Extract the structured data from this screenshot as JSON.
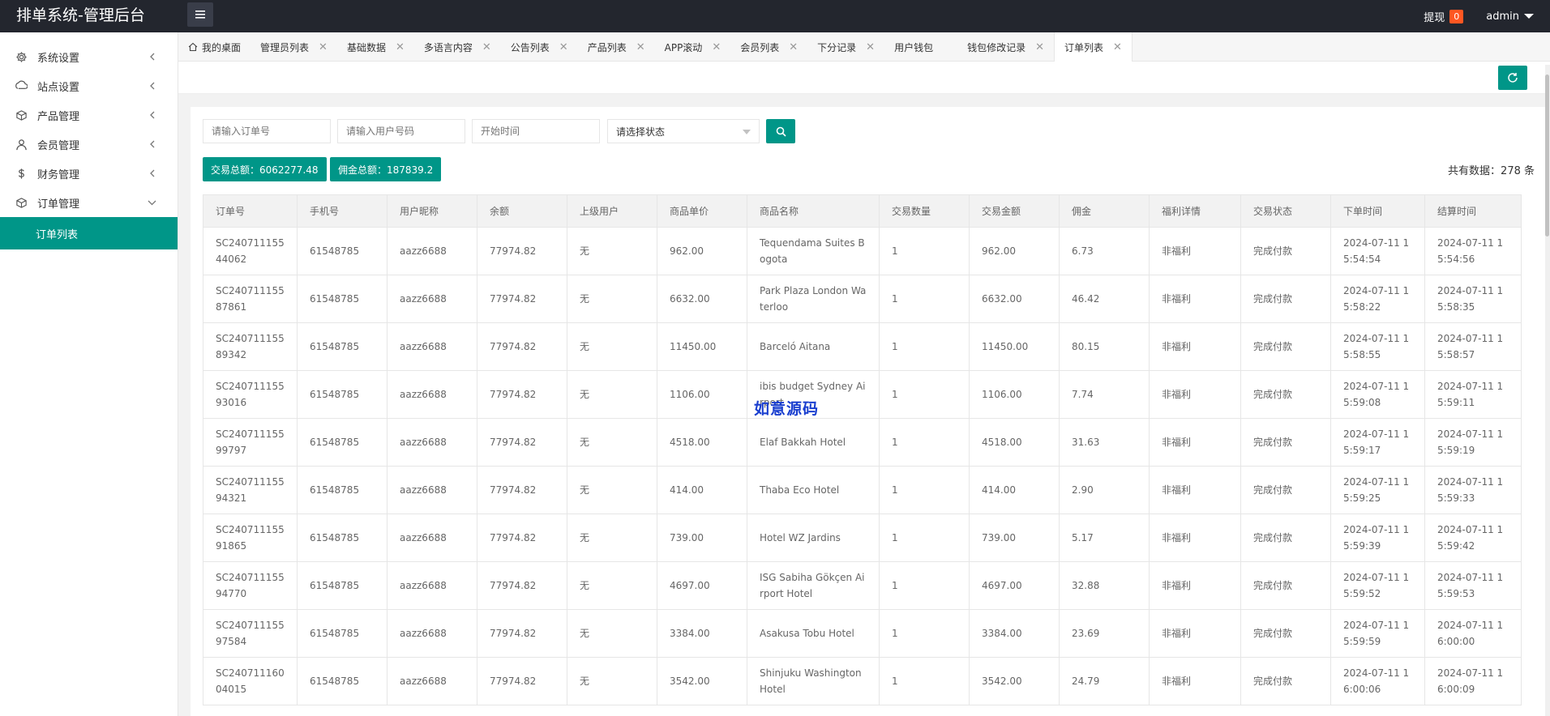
{
  "header": {
    "title": "排单系统-管理后台",
    "withdraw_label": "提现",
    "withdraw_badge": "0",
    "user": "admin"
  },
  "sidebar": {
    "items": [
      {
        "label": "系统设置",
        "icon": "gear-icon"
      },
      {
        "label": "站点设置",
        "icon": "site-icon"
      },
      {
        "label": "产品管理",
        "icon": "box-icon"
      },
      {
        "label": "会员管理",
        "icon": "user-icon"
      },
      {
        "label": "财务管理",
        "icon": "dollar-icon"
      },
      {
        "label": "订单管理",
        "icon": "cube-icon"
      }
    ],
    "sub_active": "订单列表"
  },
  "tabs": [
    {
      "label": "我的桌面",
      "closable": false
    },
    {
      "label": "管理员列表",
      "closable": true
    },
    {
      "label": "基础数据",
      "closable": true
    },
    {
      "label": "多语言内容",
      "closable": true
    },
    {
      "label": "公告列表",
      "closable": true
    },
    {
      "label": "产品列表",
      "closable": true
    },
    {
      "label": "APP滚动",
      "closable": true
    },
    {
      "label": "会员列表",
      "closable": true
    },
    {
      "label": "下分记录",
      "closable": true
    },
    {
      "label": "用户钱包",
      "closable": false
    },
    {
      "label": "钱包修改记录",
      "closable": true
    },
    {
      "label": "订单列表",
      "closable": true,
      "active": true
    }
  ],
  "filters": {
    "order_no_placeholder": "请输入订单号",
    "phone_placeholder": "请输入用户号码",
    "start_time_placeholder": "开始时间",
    "status_select": "请选择状态"
  },
  "summary": {
    "trade_total": "交易总额：6062277.48",
    "commission_total": "佣金总额：187839.2",
    "record_count": "共有数据：278 条"
  },
  "table": {
    "columns": [
      "订单号",
      "手机号",
      "用户昵称",
      "余额",
      "上级用户",
      "商品单价",
      "商品名称",
      "交易数量",
      "交易金额",
      "佣金",
      "福利详情",
      "交易状态",
      "下单时间",
      "结算时间"
    ],
    "rows": [
      [
        "SC24071115544062",
        "61548785",
        "aazz6688",
        "77974.82",
        "无",
        "962.00",
        "Tequendama Suites Bogota",
        "1",
        "962.00",
        "6.73",
        "非福利",
        "完成付款",
        "2024-07-11 15:54:54",
        "2024-07-11 15:54:56"
      ],
      [
        "SC24071115587861",
        "61548785",
        "aazz6688",
        "77974.82",
        "无",
        "6632.00",
        "Park Plaza London Waterloo",
        "1",
        "6632.00",
        "46.42",
        "非福利",
        "完成付款",
        "2024-07-11 15:58:22",
        "2024-07-11 15:58:35"
      ],
      [
        "SC24071115589342",
        "61548785",
        "aazz6688",
        "77974.82",
        "无",
        "11450.00",
        "Barceló Aitana",
        "1",
        "11450.00",
        "80.15",
        "非福利",
        "完成付款",
        "2024-07-11 15:58:55",
        "2024-07-11 15:58:57"
      ],
      [
        "SC24071115593016",
        "61548785",
        "aazz6688",
        "77974.82",
        "无",
        "1106.00",
        "ibis budget Sydney Airport",
        "1",
        "1106.00",
        "7.74",
        "非福利",
        "完成付款",
        "2024-07-11 15:59:08",
        "2024-07-11 15:59:11"
      ],
      [
        "SC24071115599797",
        "61548785",
        "aazz6688",
        "77974.82",
        "无",
        "4518.00",
        "Elaf Bakkah Hotel",
        "1",
        "4518.00",
        "31.63",
        "非福利",
        "完成付款",
        "2024-07-11 15:59:17",
        "2024-07-11 15:59:19"
      ],
      [
        "SC24071115594321",
        "61548785",
        "aazz6688",
        "77974.82",
        "无",
        "414.00",
        "Thaba Eco Hotel",
        "1",
        "414.00",
        "2.90",
        "非福利",
        "完成付款",
        "2024-07-11 15:59:25",
        "2024-07-11 15:59:33"
      ],
      [
        "SC24071115591865",
        "61548785",
        "aazz6688",
        "77974.82",
        "无",
        "739.00",
        "Hotel WZ Jardins",
        "1",
        "739.00",
        "5.17",
        "非福利",
        "完成付款",
        "2024-07-11 15:59:39",
        "2024-07-11 15:59:42"
      ],
      [
        "SC24071115594770",
        "61548785",
        "aazz6688",
        "77974.82",
        "无",
        "4697.00",
        "ISG Sabiha Gökçen Airport Hotel",
        "1",
        "4697.00",
        "32.88",
        "非福利",
        "完成付款",
        "2024-07-11 15:59:52",
        "2024-07-11 15:59:53"
      ],
      [
        "SC24071115597584",
        "61548785",
        "aazz6688",
        "77974.82",
        "无",
        "3384.00",
        "Asakusa Tobu Hotel",
        "1",
        "3384.00",
        "23.69",
        "非福利",
        "完成付款",
        "2024-07-11 15:59:59",
        "2024-07-11 16:00:00"
      ],
      [
        "SC24071116004015",
        "61548785",
        "aazz6688",
        "77974.82",
        "无",
        "3542.00",
        "Shinjuku Washington Hotel",
        "1",
        "3542.00",
        "24.79",
        "非福利",
        "完成付款",
        "2024-07-11 16:00:06",
        "2024-07-11 16:00:09"
      ]
    ]
  },
  "watermark": "如意源码",
  "colors": {
    "accent": "#009688",
    "header_bg": "#23262e",
    "badge": "#ff5722"
  }
}
